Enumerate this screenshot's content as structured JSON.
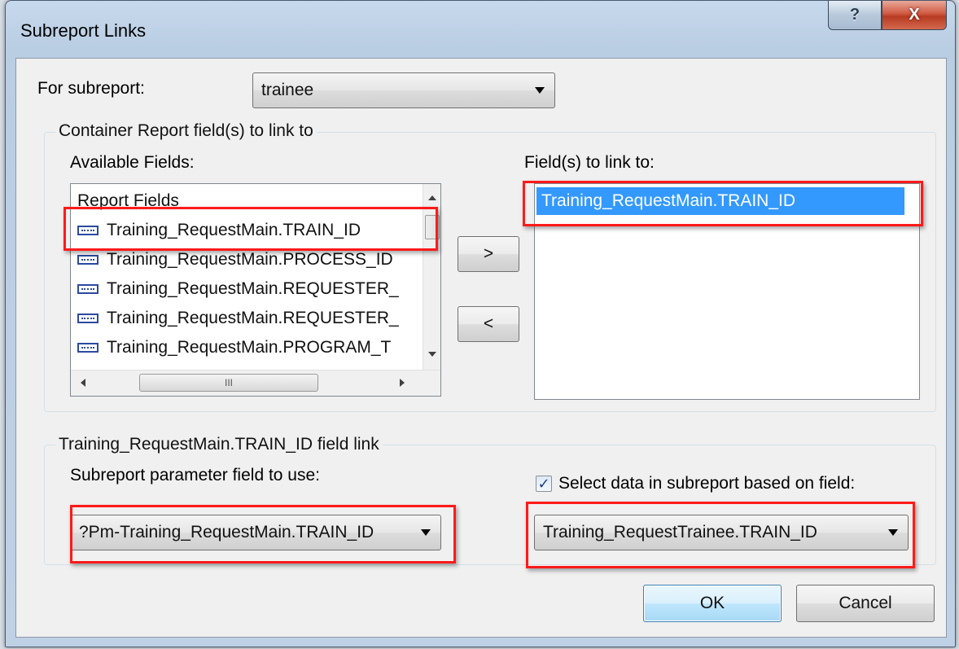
{
  "window": {
    "title": "Subreport Links",
    "help_glyph": "?",
    "close_glyph": "X"
  },
  "subreport": {
    "label": "For subreport:",
    "value": "trainee"
  },
  "container_group": {
    "legend": "Container Report field(s) to link to",
    "available_label": "Available Fields:",
    "list_header": "Report Fields",
    "items": [
      {
        "label": "Training_RequestMain.TRAIN_ID"
      },
      {
        "label": "Training_RequestMain.PROCESS_ID"
      },
      {
        "label": "Training_RequestMain.REQUESTER_"
      },
      {
        "label": "Training_RequestMain.REQUESTER_"
      },
      {
        "label": "Training_RequestMain.PROGRAM_T"
      }
    ],
    "add_button": ">",
    "remove_button": "<",
    "hscroll_grip": "III",
    "linked_label": "Field(s) to link to:",
    "linked_items": [
      {
        "label": "Training_RequestMain.TRAIN_ID",
        "selected": true
      }
    ]
  },
  "field_link_group": {
    "legend": "Training_RequestMain.TRAIN_ID field link",
    "param_label": "Subreport parameter field to use:",
    "param_value": "?Pm-Training_RequestMain.TRAIN_ID",
    "select_checkbox_label": "Select data in subreport based on field:",
    "select_checkbox_checked": true,
    "select_value": "Training_RequestTrainee.TRAIN_ID"
  },
  "footer": {
    "ok_label": "OK",
    "cancel_label": "Cancel"
  },
  "colors": {
    "highlight": "#ff1a1a",
    "selection": "#3399ff"
  }
}
